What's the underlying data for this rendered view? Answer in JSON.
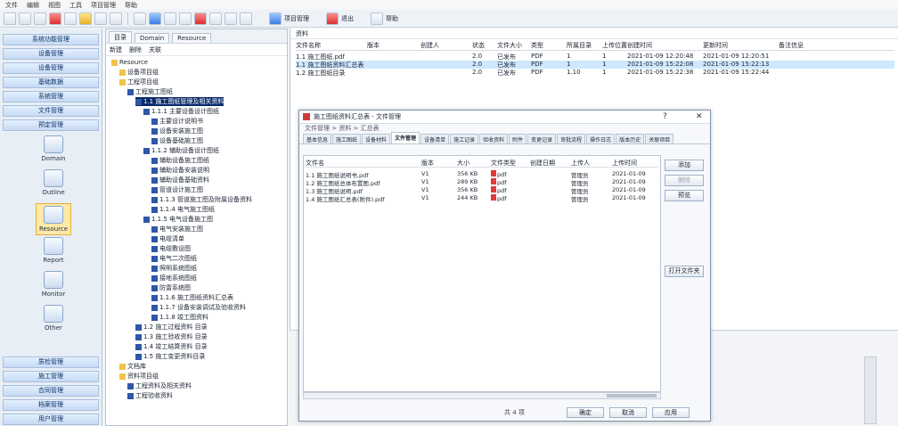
{
  "menubar": [
    "文件",
    "编辑",
    "视图",
    "工具",
    "项目管理",
    "帮助"
  ],
  "toolbar": {
    "text_buttons": [
      "项目管理",
      "退出",
      "帮助"
    ]
  },
  "leftnav": {
    "top_items": [
      "系统功能管理",
      "设备管理",
      "设备管理",
      "基础数据",
      "系统管理",
      "文件管理",
      "预定管理"
    ],
    "big_items": [
      "Domain",
      "Outline",
      "Resource",
      "Report",
      "Monitor",
      "Other"
    ],
    "active_big": 2,
    "bottom_items": [
      "质检管理",
      "施工管理",
      "合同管理",
      "档案管理",
      "用户管理"
    ]
  },
  "tree": {
    "tabs": [
      "目录",
      "Domain",
      "Resource"
    ],
    "toolbar": [
      "新建",
      "删除",
      "关联"
    ],
    "nodes": [
      "Resource",
      "设备项目组",
      "工程项目组",
      "工程施工图纸",
      "1.1 施工图纸管理及相关资料",
      "1.1.1 主要设备设计图纸",
      "主要设计说明书",
      "设备安装施工图",
      "设备基础施工图",
      "1.1.2 辅助设备设计图纸",
      "辅助设备施工图纸",
      "辅助设备安装说明",
      "辅助设备基础资料",
      "管道设计施工图",
      "1.1.3 管道施工图及附属设备资料",
      "1.1.4 电气施工图纸",
      "1.1.5 电气设备施工图",
      "电气安装施工图",
      "电缆清单",
      "电缆敷设图",
      "电气二次图纸",
      "照明系统图纸",
      "接地系统图纸",
      "防雷系统图",
      "1.1.6 施工图纸资料汇总表",
      "1.1.7 设备安装调试及验收资料",
      "1.1.8 竣工图资料",
      "1.2 施工过程资料 目录",
      "1.3 施工验收资料 目录",
      "1.4 竣工结算资料 目录",
      "1.5 施工变更资料目录",
      "文档库",
      "资料项目组",
      "工程资料及相关资料",
      "工程验收资料"
    ],
    "selected": 4
  },
  "main": {
    "caption": "资料",
    "columns": [
      "文件名称",
      "版本",
      "创建人",
      "状态",
      "文件大小",
      "类型",
      "所属目录",
      "上传位置",
      "创建时间",
      "更新时间",
      "备注信息"
    ],
    "rows": [
      [
        "1.1 施工图纸.pdf",
        "",
        "",
        "2.0",
        "已发布",
        "PDF",
        "1",
        "1",
        "2021-01-09 12:20:48",
        "2021-01-09 12:20:51",
        ""
      ],
      [
        "1.1 施工图纸资料汇总表",
        "",
        "",
        "2.0",
        "已发布",
        "PDF",
        "1",
        "1",
        "2021-01-09 15:22:08",
        "2021-01-09 15:22:13",
        ""
      ],
      [
        "1.2 施工图纸目录",
        "",
        "",
        "2.0",
        "已发布",
        "PDF",
        "1.10",
        "1",
        "2021-01-09 15:22:38",
        "2021-01-09 15:22:44",
        ""
      ]
    ],
    "selected_row": 1
  },
  "dialog": {
    "title": "施工图纸资料汇总表 - 文件管理",
    "subtitle": "文件管理 > 资料 > 汇总表",
    "tabs": [
      "基本信息",
      "施工图纸",
      "设备材料",
      "文件管理",
      "设备清单",
      "施工记录",
      "验收资料",
      "附件",
      "变更记录",
      "审批流程",
      "操作日志",
      "版本历史",
      "关联项目"
    ],
    "active_tab": 3,
    "columns": [
      "文件名",
      "版本",
      "大小",
      "文件类型",
      "创建日期",
      "上传人",
      "上传时间"
    ],
    "rows": [
      [
        "1.1 施工图纸说明书.pdf",
        "V1",
        "356 KB",
        "pdf",
        "",
        "管理员",
        "2021-01-09"
      ],
      [
        "1.2 施工图纸总体布置图.pdf",
        "V1",
        "289 KB",
        "pdf",
        "",
        "管理员",
        "2021-01-09"
      ],
      [
        "1.3 施工图纸说明.pdf",
        "V1",
        "356 KB",
        "pdf",
        "",
        "管理员",
        "2021-01-09"
      ],
      [
        "1.4 施工图纸汇总表(附件).pdf",
        "V1",
        "244 KB",
        "pdf",
        "",
        "管理员",
        "2021-01-09"
      ]
    ],
    "side_buttons": [
      "添加",
      "删除",
      "预览",
      "打开文件夹"
    ],
    "footer": {
      "label": "共 4 项",
      "buttons": [
        "确定",
        "取消",
        "应用"
      ]
    }
  }
}
